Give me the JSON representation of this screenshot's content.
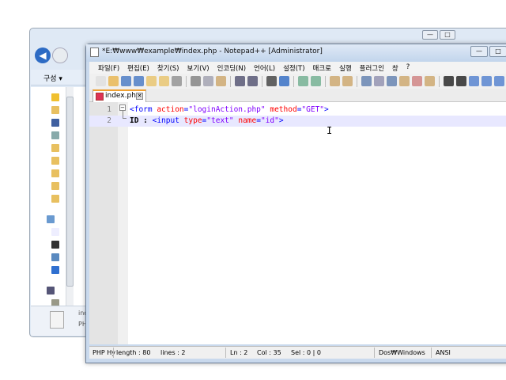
{
  "explorer": {
    "organize": "구성 ▾",
    "file_name": "ind",
    "file_type": "PH",
    "min": "—",
    "max": "□"
  },
  "notepad": {
    "title": "*E:₩www₩example₩index.php - Notepad++ [Administrator]",
    "controls": {
      "min": "—",
      "max": "□"
    },
    "menu": [
      "파일(F)",
      "편집(E)",
      "찾기(S)",
      "보기(V)",
      "인코딩(N)",
      "언어(L)",
      "설정(T)",
      "매크로",
      "실행",
      "플러그인",
      "창",
      "?"
    ],
    "toolbar_icons": [
      "new-icon",
      "open-icon",
      "save-icon",
      "save-all-icon",
      "close-icon",
      "close-all-icon",
      "print-icon",
      "|",
      "cut-icon",
      "copy-icon",
      "paste-icon",
      "|",
      "undo-icon",
      "redo-icon",
      "|",
      "find-icon",
      "replace-icon",
      "|",
      "zoom-in-icon",
      "zoom-out-icon",
      "|",
      "sync-v-icon",
      "sync-h-icon",
      "|",
      "wrap-icon",
      "show-all-chars-icon",
      "indent-guide-icon",
      "doc-map-icon",
      "function-list-icon",
      "folder-icon",
      "|",
      "record-icon",
      "stop-icon",
      "play-icon",
      "play-multi-icon",
      "save-macro-icon"
    ],
    "tab": {
      "label": "index.php",
      "close": "✕"
    },
    "lines": [
      {
        "num": "1",
        "parts": [
          {
            "t": "<form ",
            "c": "tag"
          },
          {
            "t": "action",
            "c": "attr"
          },
          {
            "t": "=",
            "c": "tag"
          },
          {
            "t": "\"loginAction.php\"",
            "c": "val"
          },
          {
            "t": " ",
            "c": "tag"
          },
          {
            "t": "method",
            "c": "attr"
          },
          {
            "t": "=",
            "c": "tag"
          },
          {
            "t": "\"GET\"",
            "c": "val"
          },
          {
            "t": ">",
            "c": "tag"
          }
        ]
      },
      {
        "num": "2",
        "parts": [
          {
            "t": "ID : ",
            "c": "txt"
          },
          {
            "t": "<input ",
            "c": "tag"
          },
          {
            "t": "type",
            "c": "attr"
          },
          {
            "t": "=",
            "c": "tag"
          },
          {
            "t": "\"text\"",
            "c": "val"
          },
          {
            "t": " ",
            "c": "tag"
          },
          {
            "t": "name",
            "c": "attr"
          },
          {
            "t": "=",
            "c": "tag"
          },
          {
            "t": "\"id\"",
            "c": "val"
          },
          {
            "t": ">",
            "c": "tag"
          }
        ]
      }
    ],
    "status": {
      "lang": "PHP Hy",
      "length": "length : 80",
      "lines": "lines : 2",
      "ln": "Ln : 2",
      "col": "Col : 35",
      "sel": "Sel : 0 | 0",
      "eol": "Dos₩Windows",
      "encoding": "ANSI"
    }
  }
}
